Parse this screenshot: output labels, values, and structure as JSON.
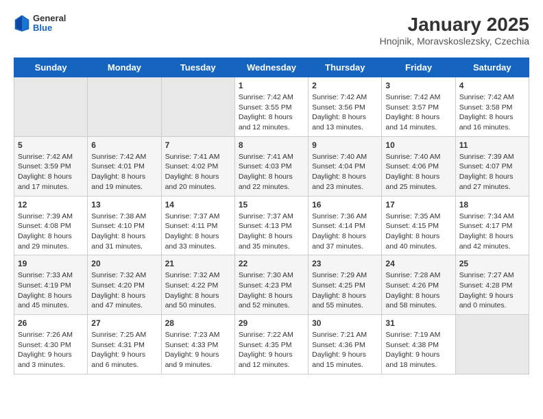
{
  "header": {
    "logo_general": "General",
    "logo_blue": "Blue",
    "title": "January 2025",
    "subtitle": "Hnojnik, Moravskoslezsky, Czechia"
  },
  "days_of_week": [
    "Sunday",
    "Monday",
    "Tuesday",
    "Wednesday",
    "Thursday",
    "Friday",
    "Saturday"
  ],
  "weeks": [
    [
      {
        "day": "",
        "info": ""
      },
      {
        "day": "",
        "info": ""
      },
      {
        "day": "",
        "info": ""
      },
      {
        "day": "1",
        "info": "Sunrise: 7:42 AM\nSunset: 3:55 PM\nDaylight: 8 hours\nand 12 minutes."
      },
      {
        "day": "2",
        "info": "Sunrise: 7:42 AM\nSunset: 3:56 PM\nDaylight: 8 hours\nand 13 minutes."
      },
      {
        "day": "3",
        "info": "Sunrise: 7:42 AM\nSunset: 3:57 PM\nDaylight: 8 hours\nand 14 minutes."
      },
      {
        "day": "4",
        "info": "Sunrise: 7:42 AM\nSunset: 3:58 PM\nDaylight: 8 hours\nand 16 minutes."
      }
    ],
    [
      {
        "day": "5",
        "info": "Sunrise: 7:42 AM\nSunset: 3:59 PM\nDaylight: 8 hours\nand 17 minutes."
      },
      {
        "day": "6",
        "info": "Sunrise: 7:42 AM\nSunset: 4:01 PM\nDaylight: 8 hours\nand 19 minutes."
      },
      {
        "day": "7",
        "info": "Sunrise: 7:41 AM\nSunset: 4:02 PM\nDaylight: 8 hours\nand 20 minutes."
      },
      {
        "day": "8",
        "info": "Sunrise: 7:41 AM\nSunset: 4:03 PM\nDaylight: 8 hours\nand 22 minutes."
      },
      {
        "day": "9",
        "info": "Sunrise: 7:40 AM\nSunset: 4:04 PM\nDaylight: 8 hours\nand 23 minutes."
      },
      {
        "day": "10",
        "info": "Sunrise: 7:40 AM\nSunset: 4:06 PM\nDaylight: 8 hours\nand 25 minutes."
      },
      {
        "day": "11",
        "info": "Sunrise: 7:39 AM\nSunset: 4:07 PM\nDaylight: 8 hours\nand 27 minutes."
      }
    ],
    [
      {
        "day": "12",
        "info": "Sunrise: 7:39 AM\nSunset: 4:08 PM\nDaylight: 8 hours\nand 29 minutes."
      },
      {
        "day": "13",
        "info": "Sunrise: 7:38 AM\nSunset: 4:10 PM\nDaylight: 8 hours\nand 31 minutes."
      },
      {
        "day": "14",
        "info": "Sunrise: 7:37 AM\nSunset: 4:11 PM\nDaylight: 8 hours\nand 33 minutes."
      },
      {
        "day": "15",
        "info": "Sunrise: 7:37 AM\nSunset: 4:13 PM\nDaylight: 8 hours\nand 35 minutes."
      },
      {
        "day": "16",
        "info": "Sunrise: 7:36 AM\nSunset: 4:14 PM\nDaylight: 8 hours\nand 37 minutes."
      },
      {
        "day": "17",
        "info": "Sunrise: 7:35 AM\nSunset: 4:15 PM\nDaylight: 8 hours\nand 40 minutes."
      },
      {
        "day": "18",
        "info": "Sunrise: 7:34 AM\nSunset: 4:17 PM\nDaylight: 8 hours\nand 42 minutes."
      }
    ],
    [
      {
        "day": "19",
        "info": "Sunrise: 7:33 AM\nSunset: 4:19 PM\nDaylight: 8 hours\nand 45 minutes."
      },
      {
        "day": "20",
        "info": "Sunrise: 7:32 AM\nSunset: 4:20 PM\nDaylight: 8 hours\nand 47 minutes."
      },
      {
        "day": "21",
        "info": "Sunrise: 7:32 AM\nSunset: 4:22 PM\nDaylight: 8 hours\nand 50 minutes."
      },
      {
        "day": "22",
        "info": "Sunrise: 7:30 AM\nSunset: 4:23 PM\nDaylight: 8 hours\nand 52 minutes."
      },
      {
        "day": "23",
        "info": "Sunrise: 7:29 AM\nSunset: 4:25 PM\nDaylight: 8 hours\nand 55 minutes."
      },
      {
        "day": "24",
        "info": "Sunrise: 7:28 AM\nSunset: 4:26 PM\nDaylight: 8 hours\nand 58 minutes."
      },
      {
        "day": "25",
        "info": "Sunrise: 7:27 AM\nSunset: 4:28 PM\nDaylight: 9 hours\nand 0 minutes."
      }
    ],
    [
      {
        "day": "26",
        "info": "Sunrise: 7:26 AM\nSunset: 4:30 PM\nDaylight: 9 hours\nand 3 minutes."
      },
      {
        "day": "27",
        "info": "Sunrise: 7:25 AM\nSunset: 4:31 PM\nDaylight: 9 hours\nand 6 minutes."
      },
      {
        "day": "28",
        "info": "Sunrise: 7:23 AM\nSunset: 4:33 PM\nDaylight: 9 hours\nand 9 minutes."
      },
      {
        "day": "29",
        "info": "Sunrise: 7:22 AM\nSunset: 4:35 PM\nDaylight: 9 hours\nand 12 minutes."
      },
      {
        "day": "30",
        "info": "Sunrise: 7:21 AM\nSunset: 4:36 PM\nDaylight: 9 hours\nand 15 minutes."
      },
      {
        "day": "31",
        "info": "Sunrise: 7:19 AM\nSunset: 4:38 PM\nDaylight: 9 hours\nand 18 minutes."
      },
      {
        "day": "",
        "info": ""
      }
    ]
  ]
}
